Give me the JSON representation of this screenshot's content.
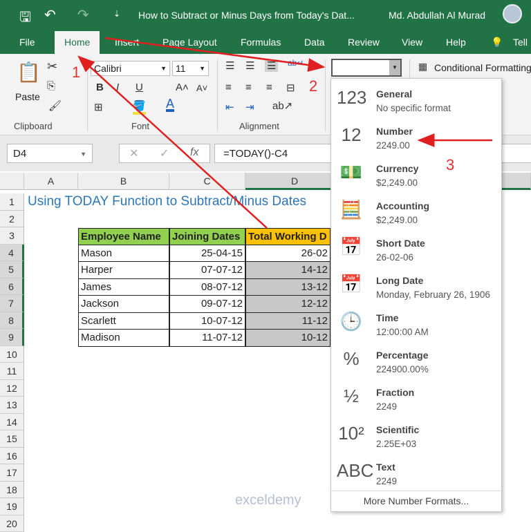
{
  "title_bar": {
    "doc_title": "How to Subtract or Minus Days from Today's Dat...",
    "user": "Md. Abdullah Al Murad"
  },
  "tabs": [
    "File",
    "Home",
    "Insert",
    "Page Layout",
    "Formulas",
    "Data",
    "Review",
    "View",
    "Help",
    "Tell"
  ],
  "ribbon": {
    "paste": "Paste",
    "font_name": "Calibri",
    "font_size": "11",
    "bold": "B",
    "italic": "I",
    "underline": "U",
    "groups": [
      "Clipboard",
      "Font",
      "Alignment"
    ],
    "number_format_value": "",
    "conditional_formatting": "Conditional Formatting"
  },
  "formula_bar": {
    "name_box": "D4",
    "fx": "fx",
    "formula": "=TODAY()-C4"
  },
  "columns": [
    "A",
    "B",
    "C",
    "D"
  ],
  "rows": [
    "1",
    "2",
    "3",
    "4",
    "5",
    "6",
    "7",
    "8",
    "9",
    "10",
    "11",
    "12",
    "13",
    "14",
    "15",
    "16",
    "17",
    "18",
    "19",
    "20"
  ],
  "sheet": {
    "title": "Using TODAY Function to Subtract/Minus Dates",
    "headers": [
      "Employee Name",
      "Joining Dates",
      "Total Working D"
    ],
    "data": [
      [
        "Mason",
        "25-04-15",
        "26-02"
      ],
      [
        "Harper",
        "07-07-12",
        "14-12"
      ],
      [
        "James",
        "08-07-12",
        "13-12"
      ],
      [
        "Jackson",
        "09-07-12",
        "12-12"
      ],
      [
        "Scarlett",
        "10-07-12",
        "11-12"
      ],
      [
        "Madison",
        "11-07-12",
        "10-12"
      ]
    ]
  },
  "number_formats": [
    {
      "name": "General",
      "example": "No specific format",
      "icon": "123"
    },
    {
      "name": "Number",
      "example": "2249.00",
      "icon": "12"
    },
    {
      "name": "Currency",
      "example": "$2,249.00",
      "icon": "💵"
    },
    {
      "name": "Accounting",
      "example": " $2,249.00",
      "icon": "🧮"
    },
    {
      "name": "Short Date",
      "example": "26-02-06",
      "icon": "📅"
    },
    {
      "name": "Long Date",
      "example": "Monday, February 26, 1906",
      "icon": "📅"
    },
    {
      "name": "Time",
      "example": "12:00:00 AM",
      "icon": "🕒"
    },
    {
      "name": "Percentage",
      "example": "224900.00%",
      "icon": "%"
    },
    {
      "name": "Fraction",
      "example": "2249",
      "icon": "½"
    },
    {
      "name": "Scientific",
      "example": "2.25E+03",
      "icon": "10²"
    },
    {
      "name": "Text",
      "example": "2249",
      "icon": "ABC"
    }
  ],
  "more_formats": "More Number Formats...",
  "annotations": [
    "1",
    "2",
    "3"
  ],
  "watermark": "exceldemy",
  "colors": {
    "excel_green": "#217346",
    "header_green": "#92d050",
    "header_orange": "#ffc000",
    "annotation_red": "#e02020",
    "title_blue": "#2e75b6"
  }
}
